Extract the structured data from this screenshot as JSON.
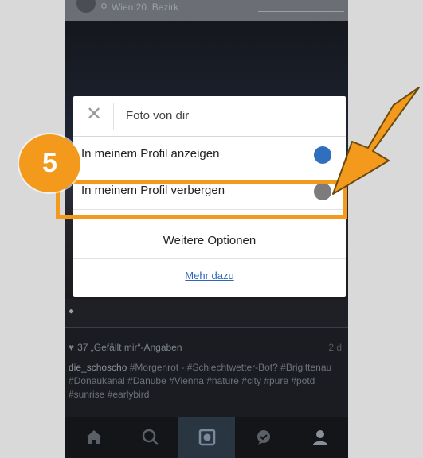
{
  "background": {
    "location": "Wien 20. Bezirk",
    "likes": "37 „Gefällt mir“-Angaben",
    "age": "2 d",
    "caption_user": "die_schoscho",
    "caption_text": " #Morgenrot - #Schlechtwetter-Bot? #Brigittenau #Donaukanal #Danube #Vienna #nature #city #pure #potd #sunrise #earlybird"
  },
  "dialog": {
    "title": "Foto von dir",
    "options": [
      {
        "label": "In meinem Profil anzeigen",
        "selected": true
      },
      {
        "label": "In meinem Profil verbergen",
        "selected": false
      }
    ],
    "more_options": "Weitere Optionen",
    "learn_more": "Mehr dazu"
  },
  "tutorial": {
    "step_number": "5"
  },
  "colors": {
    "accent": "#f39a1d",
    "radio_on": "#2f6fbd",
    "link": "#2e66b8"
  },
  "icons": {
    "close": "close-icon",
    "nav": [
      "home-icon",
      "search-icon",
      "camera-icon",
      "activity-icon",
      "profile-icon"
    ]
  }
}
